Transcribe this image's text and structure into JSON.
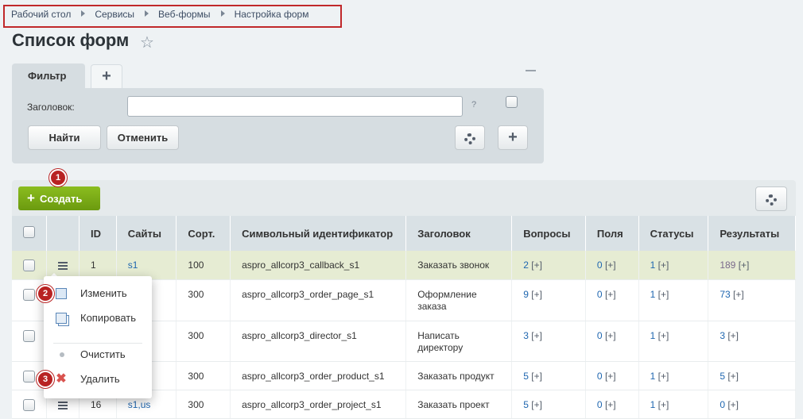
{
  "breadcrumb": [
    "Рабочий стол",
    "Сервисы",
    "Веб-формы",
    "Настройка форм"
  ],
  "page_title": "Список форм",
  "filter": {
    "tab_label": "Фильтр",
    "add_tab": "+",
    "field_label": "Заголовок:",
    "field_value": "",
    "help": "?",
    "find": "Найти",
    "cancel": "Отменить",
    "add": "+"
  },
  "toolbar": {
    "create": "Создать",
    "create_plus": "+"
  },
  "badges": [
    "1",
    "2",
    "3"
  ],
  "table": {
    "headers": [
      "ID",
      "Сайты",
      "Сорт.",
      "Символьный идентификатор",
      "Заголовок",
      "Вопросы",
      "Поля",
      "Статусы",
      "Результаты"
    ],
    "plus": "[+]",
    "rows": [
      {
        "id": "1",
        "sites": "s1",
        "sort": "100",
        "code": "aspro_allcorp3_callback_s1",
        "title": "Заказать звонок",
        "questions": "2",
        "fields": "0",
        "statuses": "1",
        "results": "189"
      },
      {
        "id": "",
        "sites": "",
        "sort": "300",
        "code": "aspro_allcorp3_order_page_s1",
        "title": "Оформление заказа",
        "questions": "9",
        "fields": "0",
        "statuses": "1",
        "results": "73"
      },
      {
        "id": "",
        "sites": "",
        "sort": "300",
        "code": "aspro_allcorp3_director_s1",
        "title": "Написать директору",
        "questions": "3",
        "fields": "0",
        "statuses": "1",
        "results": "3"
      },
      {
        "id": "",
        "sites": "",
        "sort": "300",
        "code": "aspro_allcorp3_order_product_s1",
        "title": "Заказать продукт",
        "questions": "5",
        "fields": "0",
        "statuses": "1",
        "results": "5"
      },
      {
        "id": "16",
        "sites": "s1,us",
        "sort": "300",
        "code": "aspro_allcorp3_order_project_s1",
        "title": "Заказать проект",
        "questions": "5",
        "fields": "0",
        "statuses": "1",
        "results": "0"
      }
    ]
  },
  "context_menu": {
    "edit": "Изменить",
    "copy": "Копировать",
    "clear": "Очистить",
    "delete": "Удалить"
  },
  "colors": {
    "accent_green": "#7aab17",
    "badge_red": "#b82222",
    "highlight_row": "#e6ecd3",
    "link_blue": "#2067b0"
  }
}
